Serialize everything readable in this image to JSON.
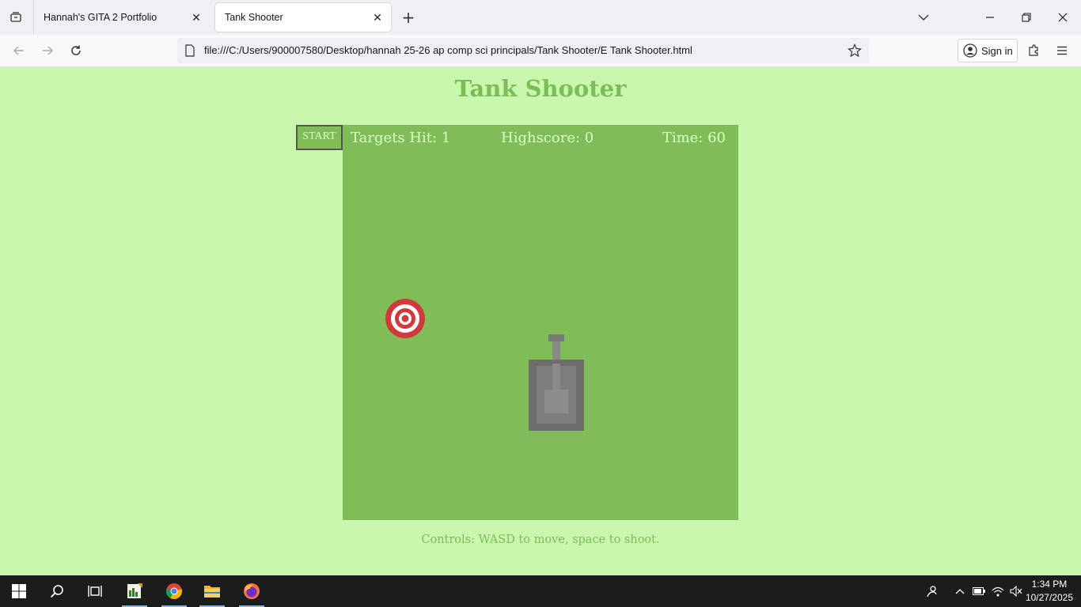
{
  "browser": {
    "tabs": [
      {
        "title": "Hannah's GITA 2 Portfolio",
        "active": false
      },
      {
        "title": "Tank Shooter",
        "active": true
      }
    ],
    "url": "file:///C:/Users/900007580/Desktop/hannah 25-26 ap comp sci principals/Tank Shooter/E Tank Shooter.html",
    "signin_label": "Sign in"
  },
  "page": {
    "title": "Tank Shooter",
    "start_label": "START",
    "hud": {
      "targets_hit": "Targets Hit: 1",
      "highscore": "Highscore: 0",
      "time": "Time: 60"
    },
    "controls": "Controls: WASD to move, space to shoot."
  },
  "colors": {
    "page_bg": "#c9f7ad",
    "game_bg": "#80bd58",
    "title": "#7bbd56",
    "hud_text": "#d9ffc6",
    "tank": "#7a7a7a",
    "target_red": "#d03a3a"
  },
  "taskbar": {
    "apps": [
      "windows-start-icon",
      "search-icon",
      "task-view-icon",
      "spreadsheet-app-icon",
      "chrome-icon",
      "file-explorer-icon",
      "firefox-icon"
    ],
    "time": "1:34 PM",
    "date": "10/27/2025"
  }
}
